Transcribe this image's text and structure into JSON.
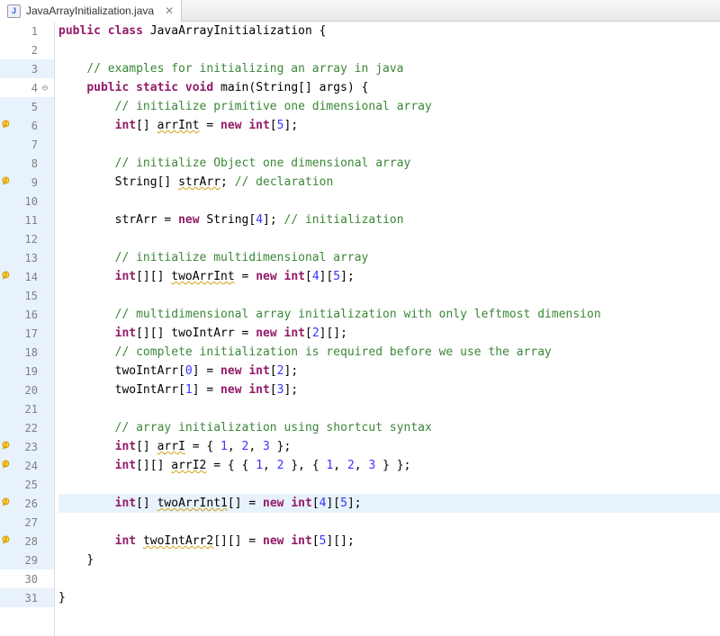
{
  "tab": {
    "filename": "JavaArrayInitialization.java",
    "iconLetter": "J"
  },
  "lines": [
    {
      "n": 1,
      "blue": false,
      "warn": false,
      "fold": "",
      "highlight": false,
      "tokens": [
        {
          "t": "kw",
          "v": "public"
        },
        {
          "t": "sp",
          "v": " "
        },
        {
          "t": "kw",
          "v": "class"
        },
        {
          "t": "sp",
          "v": " "
        },
        {
          "t": "cls",
          "v": "JavaArrayInitialization"
        },
        {
          "t": "sp",
          "v": " "
        },
        {
          "t": "paren",
          "v": "{"
        }
      ]
    },
    {
      "n": 2,
      "blue": false,
      "warn": false,
      "fold": "",
      "highlight": false,
      "tokens": []
    },
    {
      "n": 3,
      "blue": true,
      "warn": false,
      "fold": "",
      "highlight": false,
      "tokens": [
        {
          "t": "sp",
          "v": "    "
        },
        {
          "t": "cmt",
          "v": "// examples for initializing an array in java"
        }
      ]
    },
    {
      "n": 4,
      "blue": false,
      "warn": false,
      "fold": "⊖",
      "highlight": false,
      "tokens": [
        {
          "t": "sp",
          "v": "    "
        },
        {
          "t": "kw",
          "v": "public"
        },
        {
          "t": "sp",
          "v": " "
        },
        {
          "t": "kw",
          "v": "static"
        },
        {
          "t": "sp",
          "v": " "
        },
        {
          "t": "kw",
          "v": "void"
        },
        {
          "t": "sp",
          "v": " "
        },
        {
          "t": "var",
          "v": "main"
        },
        {
          "t": "paren",
          "v": "("
        },
        {
          "t": "var",
          "v": "String"
        },
        {
          "t": "paren",
          "v": "[]"
        },
        {
          "t": "sp",
          "v": " "
        },
        {
          "t": "var",
          "v": "args"
        },
        {
          "t": "paren",
          "v": ")"
        },
        {
          "t": "sp",
          "v": " "
        },
        {
          "t": "paren",
          "v": "{"
        }
      ]
    },
    {
      "n": 5,
      "blue": true,
      "warn": false,
      "fold": "",
      "highlight": false,
      "tokens": [
        {
          "t": "sp",
          "v": "        "
        },
        {
          "t": "cmt",
          "v": "// initialize primitive one dimensional array"
        }
      ]
    },
    {
      "n": 6,
      "blue": true,
      "warn": true,
      "fold": "",
      "highlight": false,
      "tokens": [
        {
          "t": "sp",
          "v": "        "
        },
        {
          "t": "type",
          "v": "int"
        },
        {
          "t": "paren",
          "v": "[]"
        },
        {
          "t": "sp",
          "v": " "
        },
        {
          "t": "warn-var",
          "v": "arrInt"
        },
        {
          "t": "sp",
          "v": " "
        },
        {
          "t": "paren",
          "v": "="
        },
        {
          "t": "sp",
          "v": " "
        },
        {
          "t": "kw",
          "v": "new"
        },
        {
          "t": "sp",
          "v": " "
        },
        {
          "t": "type",
          "v": "int"
        },
        {
          "t": "paren",
          "v": "["
        },
        {
          "t": "num",
          "v": "5"
        },
        {
          "t": "paren",
          "v": "];"
        }
      ]
    },
    {
      "n": 7,
      "blue": true,
      "warn": false,
      "fold": "",
      "highlight": false,
      "tokens": []
    },
    {
      "n": 8,
      "blue": true,
      "warn": false,
      "fold": "",
      "highlight": false,
      "tokens": [
        {
          "t": "sp",
          "v": "        "
        },
        {
          "t": "cmt",
          "v": "// initialize Object one dimensional array"
        }
      ]
    },
    {
      "n": 9,
      "blue": true,
      "warn": true,
      "fold": "",
      "highlight": false,
      "tokens": [
        {
          "t": "sp",
          "v": "        "
        },
        {
          "t": "var",
          "v": "String"
        },
        {
          "t": "paren",
          "v": "[]"
        },
        {
          "t": "sp",
          "v": " "
        },
        {
          "t": "warn-var",
          "v": "strArr"
        },
        {
          "t": "paren",
          "v": ";"
        },
        {
          "t": "sp",
          "v": " "
        },
        {
          "t": "cmt",
          "v": "// declaration"
        }
      ]
    },
    {
      "n": 10,
      "blue": true,
      "warn": false,
      "fold": "",
      "highlight": false,
      "tokens": []
    },
    {
      "n": 11,
      "blue": true,
      "warn": false,
      "fold": "",
      "highlight": false,
      "tokens": [
        {
          "t": "sp",
          "v": "        "
        },
        {
          "t": "var",
          "v": "strArr"
        },
        {
          "t": "sp",
          "v": " "
        },
        {
          "t": "paren",
          "v": "="
        },
        {
          "t": "sp",
          "v": " "
        },
        {
          "t": "kw",
          "v": "new"
        },
        {
          "t": "sp",
          "v": " "
        },
        {
          "t": "var",
          "v": "String"
        },
        {
          "t": "paren",
          "v": "["
        },
        {
          "t": "num",
          "v": "4"
        },
        {
          "t": "paren",
          "v": "];"
        },
        {
          "t": "sp",
          "v": " "
        },
        {
          "t": "cmt",
          "v": "// initialization"
        }
      ]
    },
    {
      "n": 12,
      "blue": true,
      "warn": false,
      "fold": "",
      "highlight": false,
      "tokens": []
    },
    {
      "n": 13,
      "blue": true,
      "warn": false,
      "fold": "",
      "highlight": false,
      "tokens": [
        {
          "t": "sp",
          "v": "        "
        },
        {
          "t": "cmt",
          "v": "// initialize multidimensional array"
        }
      ]
    },
    {
      "n": 14,
      "blue": true,
      "warn": true,
      "fold": "",
      "highlight": false,
      "tokens": [
        {
          "t": "sp",
          "v": "        "
        },
        {
          "t": "type",
          "v": "int"
        },
        {
          "t": "paren",
          "v": "[][]"
        },
        {
          "t": "sp",
          "v": " "
        },
        {
          "t": "warn-var",
          "v": "twoArrInt"
        },
        {
          "t": "sp",
          "v": " "
        },
        {
          "t": "paren",
          "v": "="
        },
        {
          "t": "sp",
          "v": " "
        },
        {
          "t": "kw",
          "v": "new"
        },
        {
          "t": "sp",
          "v": " "
        },
        {
          "t": "type",
          "v": "int"
        },
        {
          "t": "paren",
          "v": "["
        },
        {
          "t": "num",
          "v": "4"
        },
        {
          "t": "paren",
          "v": "]["
        },
        {
          "t": "num",
          "v": "5"
        },
        {
          "t": "paren",
          "v": "];"
        }
      ]
    },
    {
      "n": 15,
      "blue": true,
      "warn": false,
      "fold": "",
      "highlight": false,
      "tokens": []
    },
    {
      "n": 16,
      "blue": true,
      "warn": false,
      "fold": "",
      "highlight": false,
      "tokens": [
        {
          "t": "sp",
          "v": "        "
        },
        {
          "t": "cmt",
          "v": "// multidimensional array initialization with only leftmost dimension"
        }
      ]
    },
    {
      "n": 17,
      "blue": true,
      "warn": false,
      "fold": "",
      "highlight": false,
      "tokens": [
        {
          "t": "sp",
          "v": "        "
        },
        {
          "t": "type",
          "v": "int"
        },
        {
          "t": "paren",
          "v": "[][]"
        },
        {
          "t": "sp",
          "v": " "
        },
        {
          "t": "var",
          "v": "twoIntArr"
        },
        {
          "t": "sp",
          "v": " "
        },
        {
          "t": "paren",
          "v": "="
        },
        {
          "t": "sp",
          "v": " "
        },
        {
          "t": "kw",
          "v": "new"
        },
        {
          "t": "sp",
          "v": " "
        },
        {
          "t": "type",
          "v": "int"
        },
        {
          "t": "paren",
          "v": "["
        },
        {
          "t": "num",
          "v": "2"
        },
        {
          "t": "paren",
          "v": "][];"
        }
      ]
    },
    {
      "n": 18,
      "blue": true,
      "warn": false,
      "fold": "",
      "highlight": false,
      "tokens": [
        {
          "t": "sp",
          "v": "        "
        },
        {
          "t": "cmt",
          "v": "// complete initialization is required before we use the array"
        }
      ]
    },
    {
      "n": 19,
      "blue": true,
      "warn": false,
      "fold": "",
      "highlight": false,
      "tokens": [
        {
          "t": "sp",
          "v": "        "
        },
        {
          "t": "var",
          "v": "twoIntArr"
        },
        {
          "t": "paren",
          "v": "["
        },
        {
          "t": "num",
          "v": "0"
        },
        {
          "t": "paren",
          "v": "]"
        },
        {
          "t": "sp",
          "v": " "
        },
        {
          "t": "paren",
          "v": "="
        },
        {
          "t": "sp",
          "v": " "
        },
        {
          "t": "kw",
          "v": "new"
        },
        {
          "t": "sp",
          "v": " "
        },
        {
          "t": "type",
          "v": "int"
        },
        {
          "t": "paren",
          "v": "["
        },
        {
          "t": "num",
          "v": "2"
        },
        {
          "t": "paren",
          "v": "];"
        }
      ]
    },
    {
      "n": 20,
      "blue": true,
      "warn": false,
      "fold": "",
      "highlight": false,
      "tokens": [
        {
          "t": "sp",
          "v": "        "
        },
        {
          "t": "var",
          "v": "twoIntArr"
        },
        {
          "t": "paren",
          "v": "["
        },
        {
          "t": "num",
          "v": "1"
        },
        {
          "t": "paren",
          "v": "]"
        },
        {
          "t": "sp",
          "v": " "
        },
        {
          "t": "paren",
          "v": "="
        },
        {
          "t": "sp",
          "v": " "
        },
        {
          "t": "kw",
          "v": "new"
        },
        {
          "t": "sp",
          "v": " "
        },
        {
          "t": "type",
          "v": "int"
        },
        {
          "t": "paren",
          "v": "["
        },
        {
          "t": "num",
          "v": "3"
        },
        {
          "t": "paren",
          "v": "];"
        }
      ]
    },
    {
      "n": 21,
      "blue": true,
      "warn": false,
      "fold": "",
      "highlight": false,
      "tokens": []
    },
    {
      "n": 22,
      "blue": true,
      "warn": false,
      "fold": "",
      "highlight": false,
      "tokens": [
        {
          "t": "sp",
          "v": "        "
        },
        {
          "t": "cmt",
          "v": "// array initialization using shortcut syntax"
        }
      ]
    },
    {
      "n": 23,
      "blue": true,
      "warn": true,
      "fold": "",
      "highlight": false,
      "tokens": [
        {
          "t": "sp",
          "v": "        "
        },
        {
          "t": "type",
          "v": "int"
        },
        {
          "t": "paren",
          "v": "[]"
        },
        {
          "t": "sp",
          "v": " "
        },
        {
          "t": "warn-var",
          "v": "arrI"
        },
        {
          "t": "sp",
          "v": " "
        },
        {
          "t": "paren",
          "v": "="
        },
        {
          "t": "sp",
          "v": " "
        },
        {
          "t": "paren",
          "v": "{"
        },
        {
          "t": "sp",
          "v": " "
        },
        {
          "t": "num",
          "v": "1"
        },
        {
          "t": "paren",
          "v": ","
        },
        {
          "t": "sp",
          "v": " "
        },
        {
          "t": "num",
          "v": "2"
        },
        {
          "t": "paren",
          "v": ","
        },
        {
          "t": "sp",
          "v": " "
        },
        {
          "t": "num",
          "v": "3"
        },
        {
          "t": "sp",
          "v": " "
        },
        {
          "t": "paren",
          "v": "};"
        }
      ]
    },
    {
      "n": 24,
      "blue": true,
      "warn": true,
      "fold": "",
      "highlight": false,
      "tokens": [
        {
          "t": "sp",
          "v": "        "
        },
        {
          "t": "type",
          "v": "int"
        },
        {
          "t": "paren",
          "v": "[][]"
        },
        {
          "t": "sp",
          "v": " "
        },
        {
          "t": "warn-var",
          "v": "arrI2"
        },
        {
          "t": "sp",
          "v": " "
        },
        {
          "t": "paren",
          "v": "="
        },
        {
          "t": "sp",
          "v": " "
        },
        {
          "t": "paren",
          "v": "{"
        },
        {
          "t": "sp",
          "v": " "
        },
        {
          "t": "paren",
          "v": "{"
        },
        {
          "t": "sp",
          "v": " "
        },
        {
          "t": "num",
          "v": "1"
        },
        {
          "t": "paren",
          "v": ","
        },
        {
          "t": "sp",
          "v": " "
        },
        {
          "t": "num",
          "v": "2"
        },
        {
          "t": "sp",
          "v": " "
        },
        {
          "t": "paren",
          "v": "},"
        },
        {
          "t": "sp",
          "v": " "
        },
        {
          "t": "paren",
          "v": "{"
        },
        {
          "t": "sp",
          "v": " "
        },
        {
          "t": "num",
          "v": "1"
        },
        {
          "t": "paren",
          "v": ","
        },
        {
          "t": "sp",
          "v": " "
        },
        {
          "t": "num",
          "v": "2"
        },
        {
          "t": "paren",
          "v": ","
        },
        {
          "t": "sp",
          "v": " "
        },
        {
          "t": "num",
          "v": "3"
        },
        {
          "t": "sp",
          "v": " "
        },
        {
          "t": "paren",
          "v": "}"
        },
        {
          "t": "sp",
          "v": " "
        },
        {
          "t": "paren",
          "v": "};"
        }
      ]
    },
    {
      "n": 25,
      "blue": true,
      "warn": false,
      "fold": "",
      "highlight": false,
      "tokens": []
    },
    {
      "n": 26,
      "blue": true,
      "warn": true,
      "fold": "",
      "highlight": true,
      "tokens": [
        {
          "t": "sp",
          "v": "        "
        },
        {
          "t": "type",
          "v": "int"
        },
        {
          "t": "paren",
          "v": "[]"
        },
        {
          "t": "sp",
          "v": " "
        },
        {
          "t": "warn-var",
          "v": "twoArrInt1"
        },
        {
          "t": "paren",
          "v": "[]"
        },
        {
          "t": "sp",
          "v": " "
        },
        {
          "t": "paren",
          "v": "="
        },
        {
          "t": "sp",
          "v": " "
        },
        {
          "t": "kw",
          "v": "new"
        },
        {
          "t": "sp",
          "v": " "
        },
        {
          "t": "type",
          "v": "int"
        },
        {
          "t": "paren",
          "v": "["
        },
        {
          "t": "num",
          "v": "4"
        },
        {
          "t": "paren",
          "v": "]["
        },
        {
          "t": "num",
          "v": "5"
        },
        {
          "t": "paren",
          "v": "];"
        }
      ]
    },
    {
      "n": 27,
      "blue": true,
      "warn": false,
      "fold": "",
      "highlight": false,
      "tokens": []
    },
    {
      "n": 28,
      "blue": true,
      "warn": true,
      "fold": "",
      "highlight": false,
      "tokens": [
        {
          "t": "sp",
          "v": "        "
        },
        {
          "t": "type",
          "v": "int"
        },
        {
          "t": "sp",
          "v": " "
        },
        {
          "t": "warn-var",
          "v": "twoIntArr2"
        },
        {
          "t": "paren",
          "v": "[][]"
        },
        {
          "t": "sp",
          "v": " "
        },
        {
          "t": "paren",
          "v": "="
        },
        {
          "t": "sp",
          "v": " "
        },
        {
          "t": "kw",
          "v": "new"
        },
        {
          "t": "sp",
          "v": " "
        },
        {
          "t": "type",
          "v": "int"
        },
        {
          "t": "paren",
          "v": "["
        },
        {
          "t": "num",
          "v": "5"
        },
        {
          "t": "paren",
          "v": "][];"
        }
      ]
    },
    {
      "n": 29,
      "blue": true,
      "warn": false,
      "fold": "",
      "highlight": false,
      "tokens": [
        {
          "t": "sp",
          "v": "    "
        },
        {
          "t": "paren",
          "v": "}"
        }
      ]
    },
    {
      "n": 30,
      "blue": false,
      "warn": false,
      "fold": "",
      "highlight": false,
      "tokens": []
    },
    {
      "n": 31,
      "blue": true,
      "warn": false,
      "fold": "",
      "highlight": false,
      "tokens": [
        {
          "t": "paren",
          "v": "}"
        }
      ]
    }
  ]
}
